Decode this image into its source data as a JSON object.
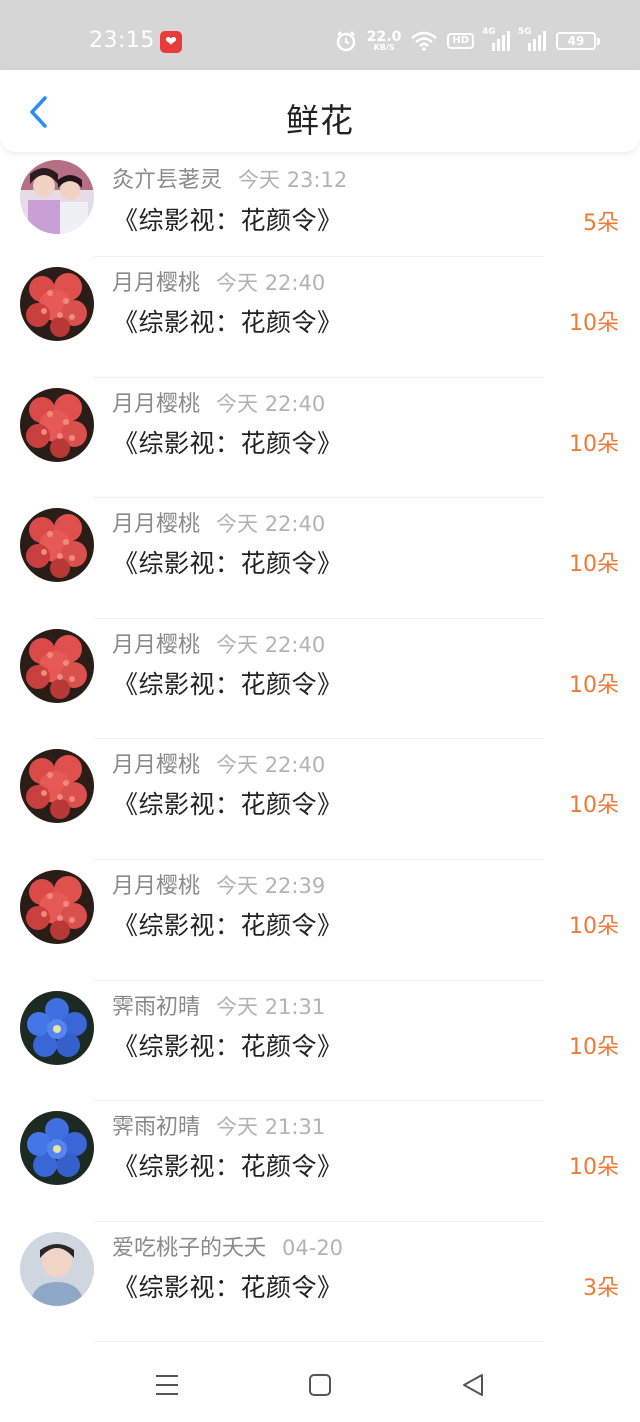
{
  "status_bar": {
    "time": "23:15",
    "net_speed_value": "22.0",
    "net_speed_unit": "KB/S",
    "hd_label": "HD",
    "sim1_label": "4G",
    "sim2_label": "5G",
    "battery": "49"
  },
  "header": {
    "title": "鲜花"
  },
  "gifts": [
    {
      "username": "灸亣镸荖灵",
      "time": "今天 23:12",
      "book": "《综影视：花颜令》",
      "count": "5朵",
      "avatar": "couple-photo"
    },
    {
      "username": "月月樱桃",
      "time": "今天 22:40",
      "book": "《综影视：花颜令》",
      "count": "10朵",
      "avatar": "red-flower"
    },
    {
      "username": "月月樱桃",
      "time": "今天 22:40",
      "book": "《综影视：花颜令》",
      "count": "10朵",
      "avatar": "red-flower"
    },
    {
      "username": "月月樱桃",
      "time": "今天 22:40",
      "book": "《综影视：花颜令》",
      "count": "10朵",
      "avatar": "red-flower"
    },
    {
      "username": "月月樱桃",
      "time": "今天 22:40",
      "book": "《综影视：花颜令》",
      "count": "10朵",
      "avatar": "red-flower"
    },
    {
      "username": "月月樱桃",
      "time": "今天 22:40",
      "book": "《综影视：花颜令》",
      "count": "10朵",
      "avatar": "red-flower"
    },
    {
      "username": "月月樱桃",
      "time": "今天 22:39",
      "book": "《综影视：花颜令》",
      "count": "10朵",
      "avatar": "red-flower"
    },
    {
      "username": "霁雨初晴",
      "time": "今天 21:31",
      "book": "《综影视：花颜令》",
      "count": "10朵",
      "avatar": "blue-flower"
    },
    {
      "username": "霁雨初晴",
      "time": "今天 21:31",
      "book": "《综影视：花颜令》",
      "count": "10朵",
      "avatar": "blue-flower"
    },
    {
      "username": "爱吃桃子的夭夭",
      "time": "04-20",
      "book": "《综影视：花颜令》",
      "count": "3朵",
      "avatar": "man-portrait"
    }
  ],
  "colors": {
    "accent_blue": "#2d8cf0",
    "count_orange": "#f07a35",
    "status_bar_bg": "#d6d6d6"
  }
}
